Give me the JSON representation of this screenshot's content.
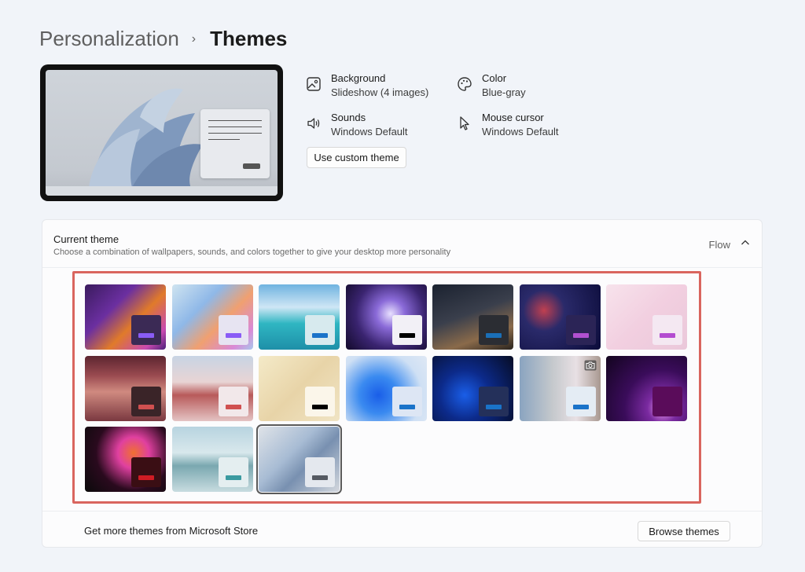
{
  "breadcrumb": {
    "parent": "Personalization",
    "separator": "›",
    "current": "Themes"
  },
  "properties": {
    "background": {
      "label": "Background",
      "value": "Slideshow (4 images)",
      "icon": "image-icon"
    },
    "color": {
      "label": "Color",
      "value": "Blue-gray",
      "icon": "palette-icon"
    },
    "sounds": {
      "label": "Sounds",
      "value": "Windows Default",
      "icon": "speaker-icon"
    },
    "cursor": {
      "label": "Mouse cursor",
      "value": "Windows Default",
      "icon": "cursor-icon"
    }
  },
  "custom_theme_button": "Use custom theme",
  "current_theme": {
    "title": "Current theme",
    "subtitle": "Choose a combination of wallpapers, sounds, and colors together to give your desktop more personality",
    "value": "Flow",
    "expanded": true
  },
  "themes": [
    {
      "bg": "linear-gradient(135deg,#3a1b5e 0%,#6b2fa0 35%,#e07a2a 60%,#c94ab0 85%,#4a1f7a 100%)",
      "card": "#3b2a55",
      "accent": "#8a5cf6"
    },
    {
      "bg": "linear-gradient(135deg,#cfe4f0 0%,#8fb8e8 35%,#f0a070 60%,#d98ad6 85%,#a8c8ec 100%)",
      "card": "#e7e4f2",
      "accent": "#8a5cf6"
    },
    {
      "bg": "linear-gradient(180deg,#6fb3e0 0%,#cfe6f5 35%,#2fb6c2 60%,#1e8fa8 100%)",
      "card": "#d7eaee",
      "accent": "#1a73c9"
    },
    {
      "bg": "radial-gradient(circle at 55% 45%,#e8e0ff 0%,#8a6ad8 25%,#3a2470 60%,#120a2a 100%)",
      "card": "#f2f0f6",
      "accent": "#000000"
    },
    {
      "bg": "linear-gradient(160deg,#1b2230 0%,#3a3f4c 45%,#8a6a4a 75%,#2a241e 100%)",
      "card": "#2b2d33",
      "accent": "#1a6fb8"
    },
    {
      "bg": "radial-gradient(circle at 30% 40%,#c04050 0%,#2a2a6a 30%,#0c0c3a 100%)",
      "card": "#2b2456",
      "accent": "#b050d0"
    },
    {
      "bg": "linear-gradient(135deg,#f7e3ec 0%,#f2cfe0 50%,#eac8da 100%)",
      "card": "#f4e8f2",
      "accent": "#b34cd0"
    },
    {
      "bg": "linear-gradient(180deg,#5c2530 0%,#9a4a50 30%,#d08a80 55%,#7a3840 100%)",
      "card": "#3a2428",
      "accent": "#d05050"
    },
    {
      "bg": "linear-gradient(180deg,#c8d4e4 0%,#e8d4d4 40%,#b85a5a 60%,#e4c4c4 100%)",
      "card": "#f2e8ea",
      "accent": "#d05050"
    },
    {
      "bg": "linear-gradient(135deg,#f4eac8 0%,#e8d4a8 50%,#f0e4c4 100%)",
      "card": "#fbf6ea",
      "accent": "#000000"
    },
    {
      "bg": "radial-gradient(circle at 40% 60%,#1a5ee8 0%,#3a8af0 30%,#cfe0f4 70%,#dfe8f4 100%)",
      "card": "#dde6f4",
      "accent": "#1a73c9"
    },
    {
      "bg": "radial-gradient(circle at 40% 60%,#1a5ee8 0%,#0c2a8a 40%,#060c24 100%)",
      "card": "#24305a",
      "accent": "#1a73c9"
    },
    {
      "bg": "linear-gradient(90deg,#8aa4c0 0%,#c4c8cc 40%,#e8e0e4 70%,#a89890 100%)",
      "card": "#e4ecf4",
      "accent": "#1a73c9",
      "camera": true
    },
    {
      "bg": "radial-gradient(circle at 70% 80%,#f0a0f0 0%,#7a2aa0 20%,#3a0c5a 50%,#12041e 100%)",
      "card": "#5a0c5a",
      "accent": "#5a0c5a"
    },
    {
      "bg": "radial-gradient(circle at 60% 40%,#f07030 0%,#e040a0 25%,#2a0a1e 60%,#0a0a0a 100%)",
      "card": "#3a0e14",
      "accent": "#d01c24"
    },
    {
      "bg": "linear-gradient(180deg,#b8d4e0 0%,#d8e8ec 40%,#7aa8b0 60%,#c8dce0 100%)",
      "card": "#e4eef0",
      "accent": "#3a9aa0"
    },
    {
      "bg": "linear-gradient(135deg,#dfe3e8 0%,#a8bcd4 40%,#7890b0 60%,#d4d8de 100%)",
      "card": "#e4e8ee",
      "accent": "#555a62",
      "selected": true
    }
  ],
  "footer": {
    "text": "Get more themes from Microsoft Store",
    "button": "Browse themes"
  }
}
